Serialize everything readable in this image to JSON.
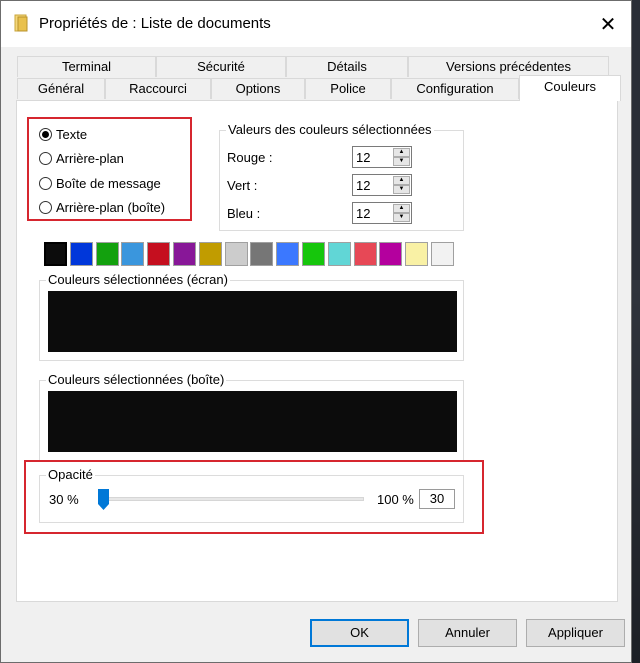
{
  "window": {
    "title": "Propriétés de : Liste de documents",
    "close_glyph": "✕"
  },
  "tabs": {
    "row1": [
      "Terminal",
      "Sécurité",
      "Détails",
      "Versions précédentes"
    ],
    "row2": [
      "Général",
      "Raccourci",
      "Options",
      "Police",
      "Configuration",
      "Couleurs"
    ],
    "active": "Couleurs"
  },
  "color_targets": {
    "options": [
      "Texte",
      "Arrière-plan",
      "Boîte de message",
      "Arrière-plan (boîte)"
    ],
    "selected_index": 0
  },
  "selected_values": {
    "legend": "Valeurs des couleurs sélectionnées",
    "red_label": "Rouge :",
    "red_value": "12",
    "green_label": "Vert :",
    "green_value": "12",
    "blue_label": "Bleu :",
    "blue_value": "12",
    "spin_up_glyph": "▲",
    "spin_down_glyph": "▼"
  },
  "palette": {
    "colors": [
      "#0c0c0c",
      "#0037da",
      "#13a10e",
      "#3a96dd",
      "#c50f1f",
      "#881798",
      "#c19c00",
      "#cccccc",
      "#767676",
      "#3b78ff",
      "#16c60c",
      "#61d6d6",
      "#e74856",
      "#b4009e",
      "#f9f1a5",
      "#f2f2f2"
    ],
    "selected_index": 0
  },
  "screen_preview": {
    "legend": "Couleurs sélectionnées (écran)"
  },
  "popup_preview": {
    "legend": "Couleurs sélectionnées (boîte)"
  },
  "opacity": {
    "legend": "Opacité",
    "min_label": "30 %",
    "max_label": "100 %",
    "value": "30"
  },
  "buttons": {
    "ok": "OK",
    "cancel": "Annuler",
    "apply": "Appliquer"
  },
  "colors": {
    "highlight": "#d6262f",
    "accent": "#0078d7",
    "preview_bg": "#0c0c0c"
  }
}
